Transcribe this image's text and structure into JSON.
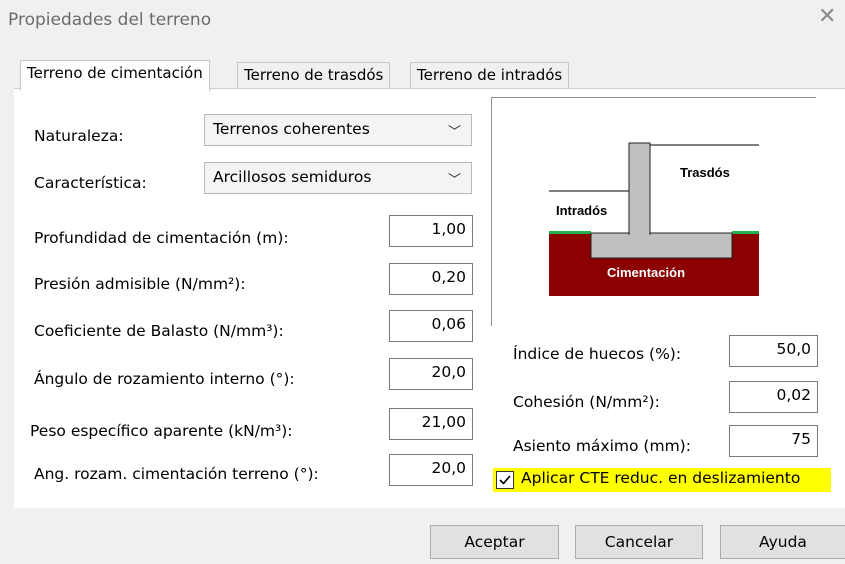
{
  "dialog": {
    "title": "Propiedades del terreno"
  },
  "tabs": [
    {
      "label": "Terreno de cimentación"
    },
    {
      "label": "Terreno de trasdós"
    },
    {
      "label": "Terreno de intradós"
    }
  ],
  "form": {
    "naturaleza": {
      "label": "Naturaleza:",
      "value": "Terrenos coherentes"
    },
    "caracteristica": {
      "label": "Característica:",
      "value": "Arcillosos semiduros"
    },
    "profundidad": {
      "label": "Profundidad de cimentación (m):",
      "value": "1,00"
    },
    "presion": {
      "label": "Presión admisible (N/mm²):",
      "value": "0,20"
    },
    "balasto": {
      "label": "Coeficiente de Balasto (N/mm³):",
      "value": "0,06"
    },
    "angulo": {
      "label": "Ángulo de rozamiento interno (°):",
      "value": "20,0"
    },
    "peso": {
      "label": "Peso específico aparente (kN/m³):",
      "value": "21,00"
    },
    "ang_rozam": {
      "label": "Ang. rozam. cimentación terreno (°):",
      "value": "20,0"
    },
    "indice": {
      "label": "Índice de huecos (%):",
      "value": "50,0"
    },
    "cohesion": {
      "label": "Cohesión (N/mm²):",
      "value": "0,02"
    },
    "asiento": {
      "label": "Asiento máximo (mm):",
      "value": "75"
    }
  },
  "diagram": {
    "trasdos": "Trasdós",
    "intrados": "Intradós",
    "cimentacion": "Cimentación",
    "colors": {
      "ground": "#8b0000",
      "footing": "#c0c0c0",
      "grass": "#22b14c"
    }
  },
  "checkbox": {
    "label": "Aplicar CTE reduc. en deslizamiento",
    "checked": true
  },
  "buttons": {
    "accept": "Aceptar",
    "cancel": "Cancelar",
    "help": "Ayuda"
  }
}
